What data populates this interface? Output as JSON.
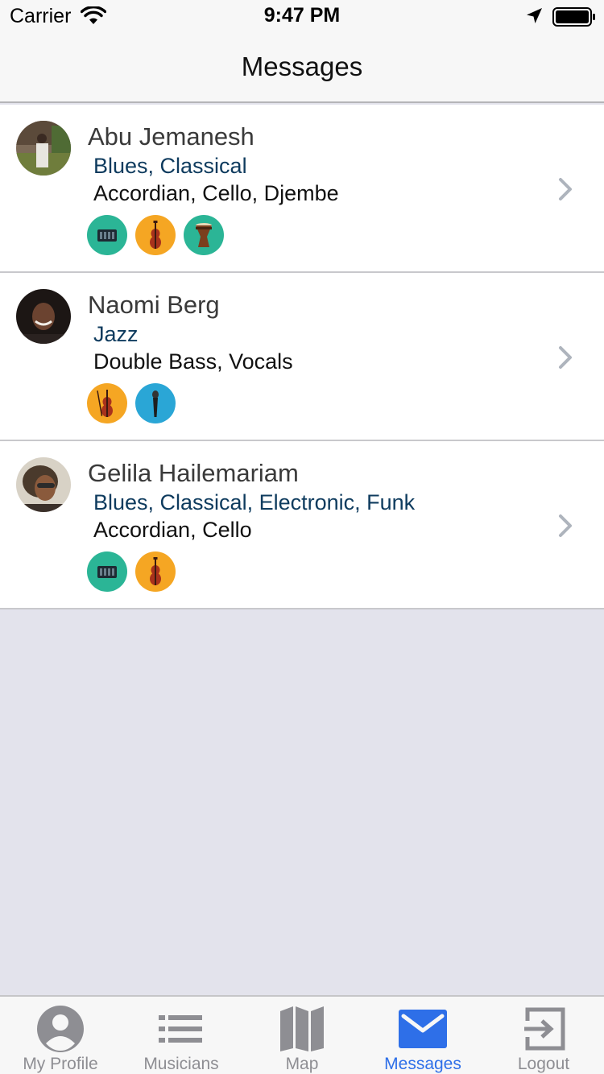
{
  "status_bar": {
    "carrier": "Carrier",
    "time": "9:47 PM",
    "icons": [
      "wifi-icon",
      "location-arrow-icon",
      "battery-icon"
    ]
  },
  "nav": {
    "title": "Messages"
  },
  "conversations": [
    {
      "name": "Abu Jemanesh",
      "genres": "Blues, Classical",
      "instruments": "Accordian, Cello, Djembe",
      "badges": [
        "accordion-icon",
        "cello-icon",
        "djembe-icon"
      ]
    },
    {
      "name": "Naomi Berg",
      "genres": "Jazz",
      "instruments": "Double Bass, Vocals",
      "badges": [
        "double-bass-icon",
        "microphone-icon"
      ]
    },
    {
      "name": "Gelila Hailemariam",
      "genres": "Blues, Classical, Electronic, Funk",
      "instruments": "Accordian, Cello",
      "badges": [
        "accordion-icon",
        "cello-icon"
      ]
    }
  ],
  "tab_bar": {
    "tabs": [
      {
        "label": "My Profile",
        "icon": "person-icon",
        "active": false
      },
      {
        "label": "Musicians",
        "icon": "list-icon",
        "active": false
      },
      {
        "label": "Map",
        "icon": "map-icon",
        "active": false
      },
      {
        "label": "Messages",
        "icon": "envelope-icon",
        "active": true
      },
      {
        "label": "Logout",
        "icon": "logout-icon",
        "active": false
      }
    ]
  },
  "colors": {
    "accent": "#2e6fe8",
    "genre_text": "#0e3b5e",
    "badge_teal": "#2bb596",
    "badge_orange": "#f5a623",
    "badge_blue": "#2aa6d6"
  }
}
